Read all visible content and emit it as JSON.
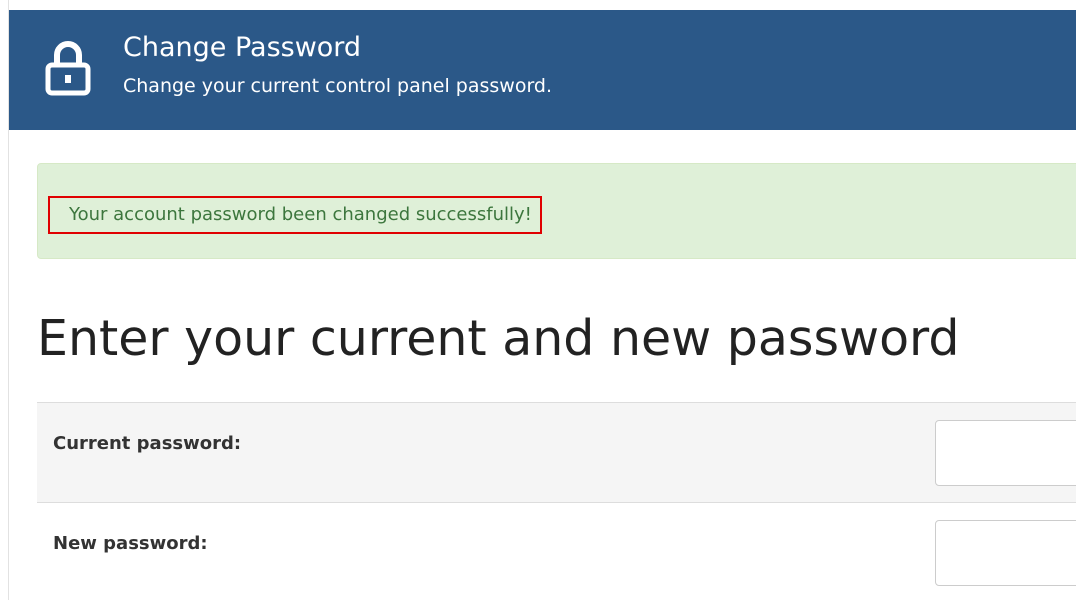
{
  "header": {
    "icon": "lock-icon",
    "title": "Change Password",
    "subtitle": "Change your current control panel password."
  },
  "alert": {
    "message": "Your account password been changed successfully!",
    "colors": {
      "background": "#dff0d8",
      "text": "#3c763d",
      "highlight_border": "#e00000"
    }
  },
  "form": {
    "heading": "Enter your current and new password",
    "fields": [
      {
        "label": "Current password:",
        "value": "",
        "placeholder": ""
      },
      {
        "label": "New password:",
        "value": "",
        "placeholder": ""
      }
    ]
  },
  "colors": {
    "header_background": "#2b5888"
  }
}
